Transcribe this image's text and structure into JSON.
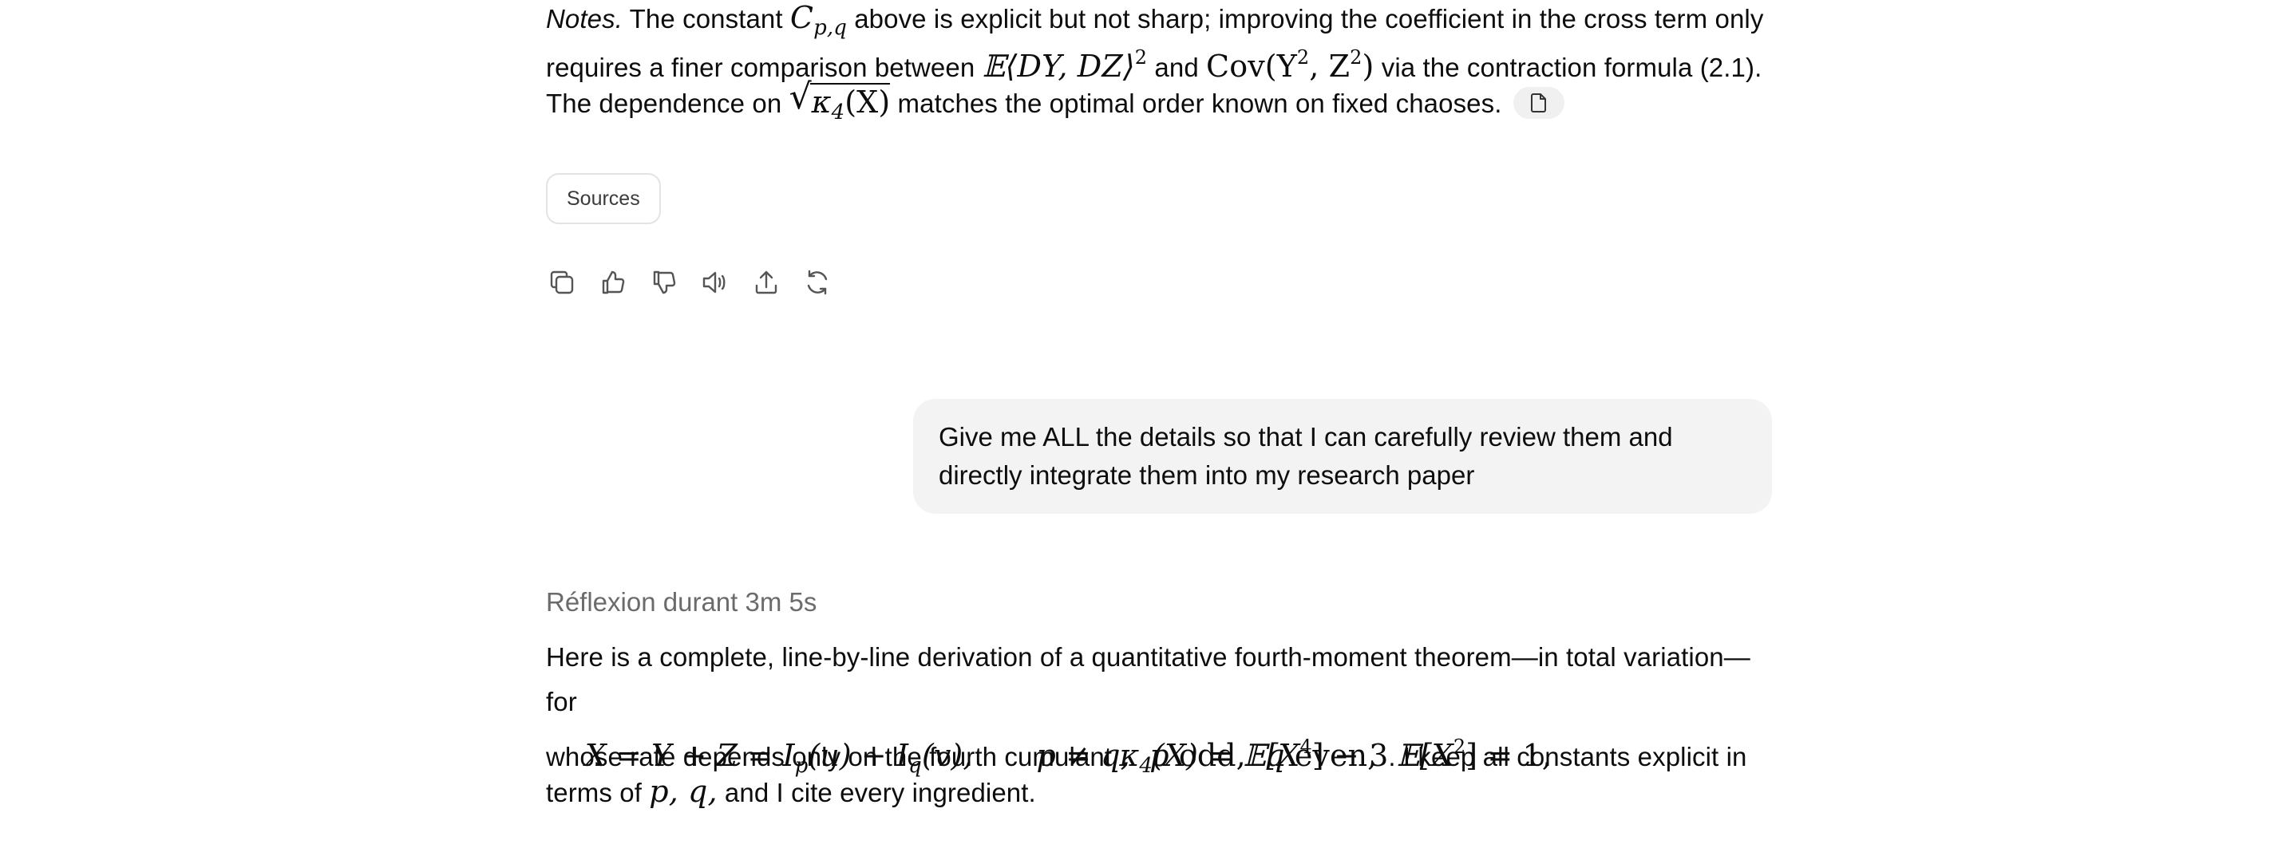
{
  "notes": {
    "notes_label": "Notes.",
    "t1": " The constant ",
    "c_sym": "C",
    "c_sub": "p,q",
    "t2": " above is explicit but not sharp; improving the coefficient in the cross term only",
    "t3": "requires a finer comparison between ",
    "expect_expr": "𝔼⟨DY, DZ⟩",
    "expect_sup": "2",
    "t4": " and ",
    "cov_expr": "Cov(Y",
    "cov_sup1": "2",
    "cov_mid": ", Z",
    "cov_sup2": "2",
    "cov_end": ")",
    "t5": " via the contraction formula (2.1).",
    "t6": "The dependence on ",
    "sqrt_kappa": "κ",
    "sqrt_sub": "4",
    "sqrt_arg": "(X)",
    "t7": " matches the optimal order known on fixed chaoses."
  },
  "sources_label": "Sources",
  "actions": {
    "copy": "copy-icon",
    "thumbs_up": "thumbs-up-icon",
    "thumbs_down": "thumbs-down-icon",
    "read_aloud": "speaker-icon",
    "share": "share-icon",
    "regenerate": "regenerate-icon"
  },
  "user_message": {
    "line1": "Give me ALL the details so that I can carefully review them and",
    "line2": "directly integrate them into my research paper"
  },
  "thinking_label": "Réflexion durant 3m 5s",
  "answer": {
    "line1": "Here is a complete, line-by-line derivation of a quantitative fourth-moment theorem—in total variation—for",
    "eq_left": "X = Y + Z = I",
    "eq_p": "p",
    "eq_u": "(u) + I",
    "eq_q": "q",
    "eq_v": "(v),",
    "eq_cond1": "p ≠ q,  p",
    "eq_odd": " odd,  ",
    "eq_q2": "q",
    "eq_even": " even,  ",
    "eq_expect": "𝔼[X",
    "eq_sup": "2",
    "eq_end": "] = 1,",
    "line3a": "whose rate depends only on the fourth cumulant ",
    "k4_kappa": "κ",
    "k4_sub": "4",
    "k4_mid": "(X) = 𝔼[X",
    "k4_sup": "4",
    "k4_end": "] − 3",
    "line3b": ". I keep all constants explicit in",
    "line4a": "terms of ",
    "pq": "p, q,",
    "line4b": " and I cite every ingredient."
  }
}
